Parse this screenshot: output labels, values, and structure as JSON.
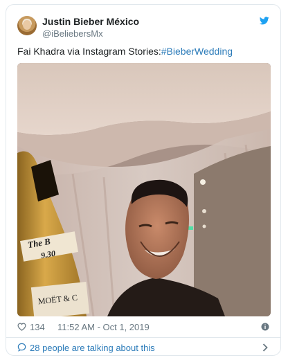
{
  "tweet": {
    "display_name": "Justin Bieber México",
    "handle": "@iBeliebersMx",
    "text": "Fai Khadra via Instagram Stories:",
    "hashtag": "#BieberWedding",
    "likes": "134",
    "timestamp": "11:52 AM - Oct 1, 2019",
    "talking": "28 people are talking about this"
  },
  "photo_labels": {
    "bottle_label_1": "The B",
    "bottle_label_2": "9.30",
    "bottle_brand": "MOËT & C"
  },
  "colors": {
    "link": "#2b7bb9",
    "muted": "#697882",
    "border": "#e1e8ed",
    "twitter_blue": "#1da1f2"
  },
  "icons": [
    "twitter-bird-icon",
    "heart-icon",
    "info-icon",
    "speech-bubble-icon",
    "chevron-right-icon"
  ]
}
